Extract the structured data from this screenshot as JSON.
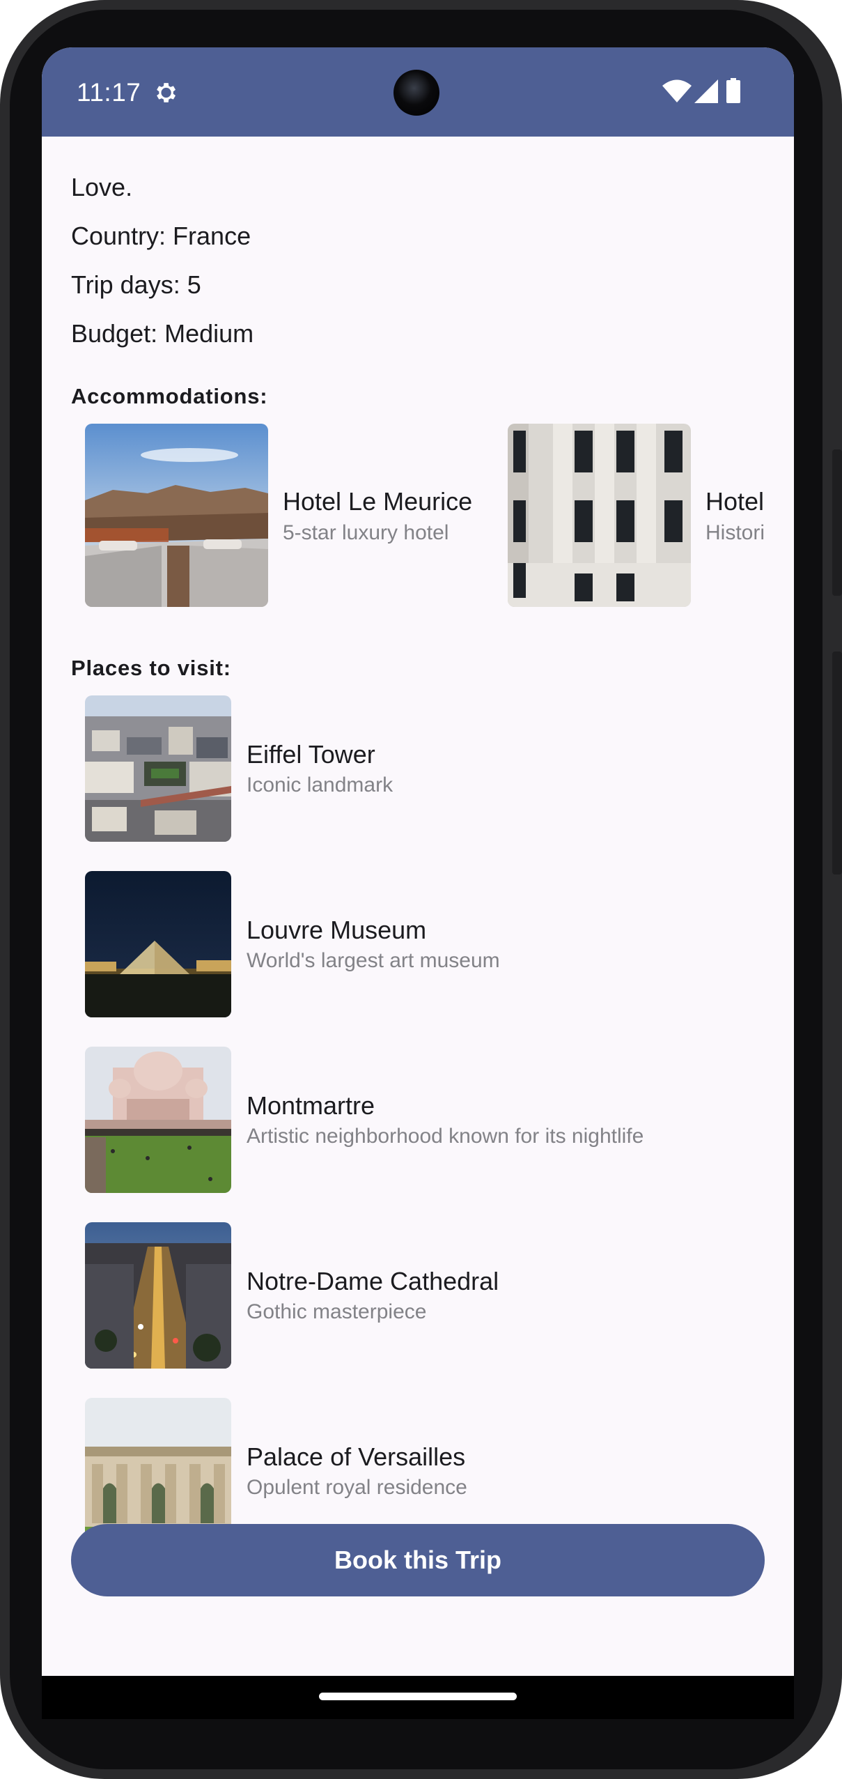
{
  "status_bar": {
    "time": "11:17",
    "icons": [
      "gear-icon",
      "wifi-icon",
      "signal-icon",
      "battery-icon"
    ],
    "background": "#4e5f94"
  },
  "trip": {
    "title": "Love.",
    "country": "Country: France",
    "days": "Trip days: 5",
    "budget": "Budget: Medium"
  },
  "accommodations": {
    "heading": "Accommodations:",
    "items": [
      {
        "name": "Hotel Le Meurice",
        "description": "5-star luxury hotel"
      },
      {
        "name": "Hotel",
        "description": "Histori"
      }
    ]
  },
  "places": {
    "heading": "Places to visit:",
    "items": [
      {
        "name": "Eiffel Tower",
        "description": "Iconic landmark"
      },
      {
        "name": "Louvre Museum",
        "description": "World's largest art museum"
      },
      {
        "name": "Montmartre",
        "description": "Artistic neighborhood known for its nightlife"
      },
      {
        "name": "Notre-Dame Cathedral",
        "description": "Gothic masterpiece"
      },
      {
        "name": "Palace of Versailles",
        "description": "Opulent royal residence"
      }
    ]
  },
  "actions": {
    "book_label": "Book this Trip"
  },
  "colors": {
    "accent": "#4e5f94",
    "background": "#fbf8fc",
    "text": "#1b1b1f",
    "secondary_text": "#828287"
  }
}
